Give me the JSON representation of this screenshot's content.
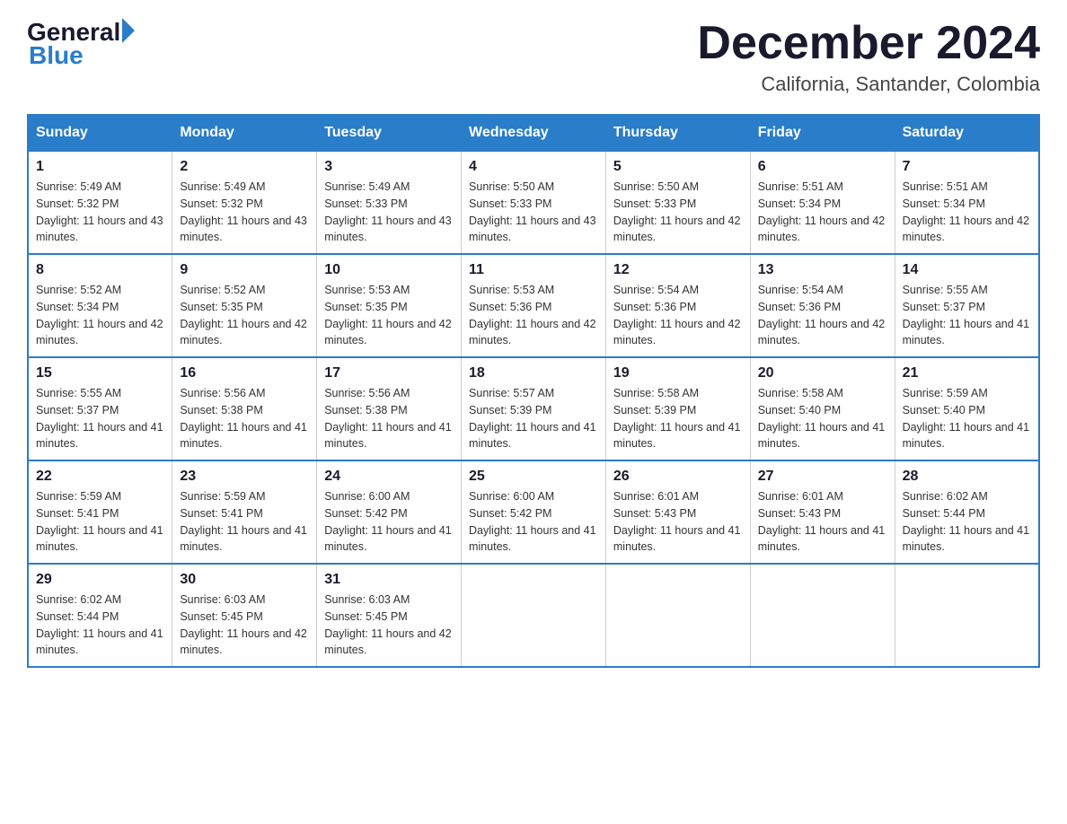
{
  "logo": {
    "general": "General",
    "blue": "Blue"
  },
  "title": {
    "month": "December 2024",
    "location": "California, Santander, Colombia"
  },
  "weekdays": [
    "Sunday",
    "Monday",
    "Tuesday",
    "Wednesday",
    "Thursday",
    "Friday",
    "Saturday"
  ],
  "weeks": [
    [
      {
        "day": "1",
        "sunrise": "5:49 AM",
        "sunset": "5:32 PM",
        "daylight": "11 hours and 43 minutes."
      },
      {
        "day": "2",
        "sunrise": "5:49 AM",
        "sunset": "5:32 PM",
        "daylight": "11 hours and 43 minutes."
      },
      {
        "day": "3",
        "sunrise": "5:49 AM",
        "sunset": "5:33 PM",
        "daylight": "11 hours and 43 minutes."
      },
      {
        "day": "4",
        "sunrise": "5:50 AM",
        "sunset": "5:33 PM",
        "daylight": "11 hours and 43 minutes."
      },
      {
        "day": "5",
        "sunrise": "5:50 AM",
        "sunset": "5:33 PM",
        "daylight": "11 hours and 42 minutes."
      },
      {
        "day": "6",
        "sunrise": "5:51 AM",
        "sunset": "5:34 PM",
        "daylight": "11 hours and 42 minutes."
      },
      {
        "day": "7",
        "sunrise": "5:51 AM",
        "sunset": "5:34 PM",
        "daylight": "11 hours and 42 minutes."
      }
    ],
    [
      {
        "day": "8",
        "sunrise": "5:52 AM",
        "sunset": "5:34 PM",
        "daylight": "11 hours and 42 minutes."
      },
      {
        "day": "9",
        "sunrise": "5:52 AM",
        "sunset": "5:35 PM",
        "daylight": "11 hours and 42 minutes."
      },
      {
        "day": "10",
        "sunrise": "5:53 AM",
        "sunset": "5:35 PM",
        "daylight": "11 hours and 42 minutes."
      },
      {
        "day": "11",
        "sunrise": "5:53 AM",
        "sunset": "5:36 PM",
        "daylight": "11 hours and 42 minutes."
      },
      {
        "day": "12",
        "sunrise": "5:54 AM",
        "sunset": "5:36 PM",
        "daylight": "11 hours and 42 minutes."
      },
      {
        "day": "13",
        "sunrise": "5:54 AM",
        "sunset": "5:36 PM",
        "daylight": "11 hours and 42 minutes."
      },
      {
        "day": "14",
        "sunrise": "5:55 AM",
        "sunset": "5:37 PM",
        "daylight": "11 hours and 41 minutes."
      }
    ],
    [
      {
        "day": "15",
        "sunrise": "5:55 AM",
        "sunset": "5:37 PM",
        "daylight": "11 hours and 41 minutes."
      },
      {
        "day": "16",
        "sunrise": "5:56 AM",
        "sunset": "5:38 PM",
        "daylight": "11 hours and 41 minutes."
      },
      {
        "day": "17",
        "sunrise": "5:56 AM",
        "sunset": "5:38 PM",
        "daylight": "11 hours and 41 minutes."
      },
      {
        "day": "18",
        "sunrise": "5:57 AM",
        "sunset": "5:39 PM",
        "daylight": "11 hours and 41 minutes."
      },
      {
        "day": "19",
        "sunrise": "5:58 AM",
        "sunset": "5:39 PM",
        "daylight": "11 hours and 41 minutes."
      },
      {
        "day": "20",
        "sunrise": "5:58 AM",
        "sunset": "5:40 PM",
        "daylight": "11 hours and 41 minutes."
      },
      {
        "day": "21",
        "sunrise": "5:59 AM",
        "sunset": "5:40 PM",
        "daylight": "11 hours and 41 minutes."
      }
    ],
    [
      {
        "day": "22",
        "sunrise": "5:59 AM",
        "sunset": "5:41 PM",
        "daylight": "11 hours and 41 minutes."
      },
      {
        "day": "23",
        "sunrise": "5:59 AM",
        "sunset": "5:41 PM",
        "daylight": "11 hours and 41 minutes."
      },
      {
        "day": "24",
        "sunrise": "6:00 AM",
        "sunset": "5:42 PM",
        "daylight": "11 hours and 41 minutes."
      },
      {
        "day": "25",
        "sunrise": "6:00 AM",
        "sunset": "5:42 PM",
        "daylight": "11 hours and 41 minutes."
      },
      {
        "day": "26",
        "sunrise": "6:01 AM",
        "sunset": "5:43 PM",
        "daylight": "11 hours and 41 minutes."
      },
      {
        "day": "27",
        "sunrise": "6:01 AM",
        "sunset": "5:43 PM",
        "daylight": "11 hours and 41 minutes."
      },
      {
        "day": "28",
        "sunrise": "6:02 AM",
        "sunset": "5:44 PM",
        "daylight": "11 hours and 41 minutes."
      }
    ],
    [
      {
        "day": "29",
        "sunrise": "6:02 AM",
        "sunset": "5:44 PM",
        "daylight": "11 hours and 41 minutes."
      },
      {
        "day": "30",
        "sunrise": "6:03 AM",
        "sunset": "5:45 PM",
        "daylight": "11 hours and 42 minutes."
      },
      {
        "day": "31",
        "sunrise": "6:03 AM",
        "sunset": "5:45 PM",
        "daylight": "11 hours and 42 minutes."
      },
      null,
      null,
      null,
      null
    ]
  ]
}
